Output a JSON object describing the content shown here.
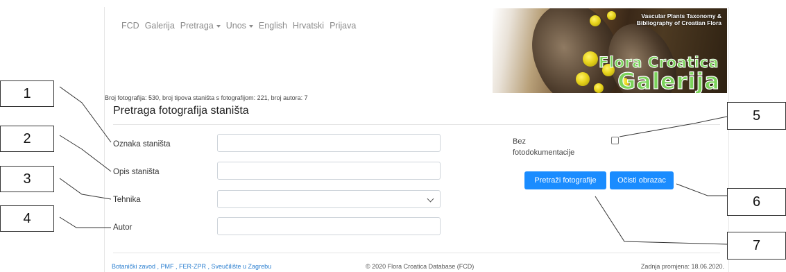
{
  "nav": {
    "items": [
      "FCD",
      "Galerija",
      "Pretraga",
      "Unos",
      "English",
      "Hrvatski",
      "Prijava"
    ]
  },
  "banner": {
    "subtitle_line1": "Vascular Plants Taxonomy &",
    "subtitle_line2": "Bibliography of Croatian Flora",
    "title_line1": "Flora Croatica",
    "title_line2": "Galerija"
  },
  "stats": "Broj fotografija: 530, broj tipova staništa s fotografijom: 221, broj autora: 7",
  "page_title": "Pretraga fotografija staništa",
  "form": {
    "label_oznaka": "Oznaka staništa",
    "label_opis": "Opis staništa",
    "label_tehnika": "Tehnika",
    "label_autor": "Autor",
    "bez_line1": "Bez",
    "bez_line2": "fotodokumentacije",
    "btn_search": "Pretraži fotografije",
    "btn_clear": "Očisti obrazac"
  },
  "footer": {
    "links": "Botanički zavod , PMF , FER-ZPR , Sveučilište u Zagrebu",
    "copyright": "© 2020 Flora Croatica Database (FCD)",
    "last_change": "Zadnja promjena: 18.06.2020."
  },
  "callouts": [
    "1",
    "2",
    "3",
    "4",
    "5",
    "6",
    "7"
  ],
  "colors": {
    "button": "#1a8cff",
    "banner_title": "#7bd35a",
    "link": "#2b7fd0"
  }
}
